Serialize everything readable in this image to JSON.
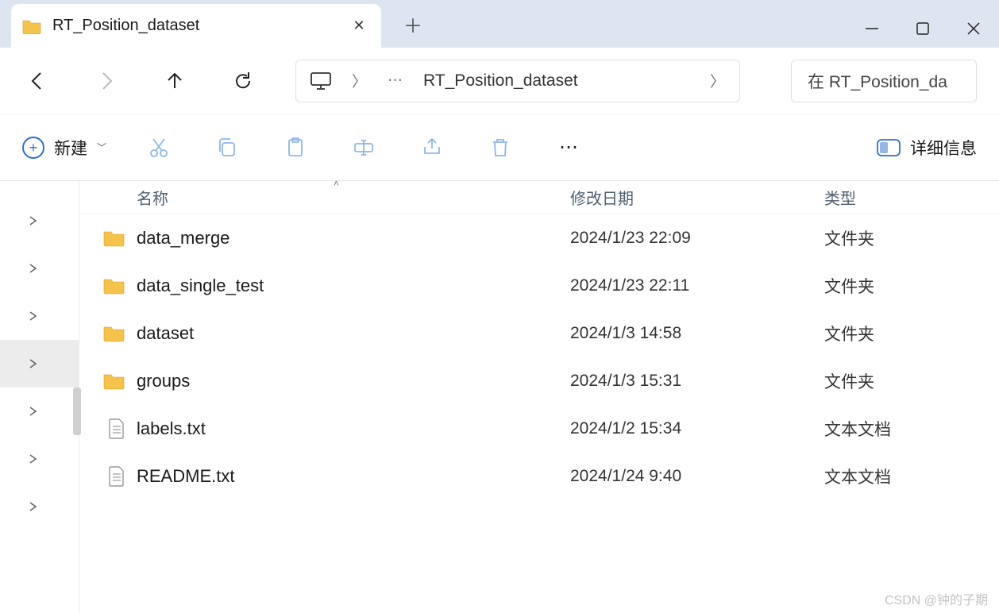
{
  "window": {
    "tab_title": "RT_Position_dataset"
  },
  "address": {
    "crumb": "RT_Position_dataset"
  },
  "search": {
    "placeholder": "在 RT_Position_da"
  },
  "toolbar": {
    "new_label": "新建",
    "details_label": "详细信息"
  },
  "columns": {
    "name": "名称",
    "modified": "修改日期",
    "type": "类型"
  },
  "files": [
    {
      "name": "data_merge",
      "date": "2024/1/23 22:09",
      "type": "文件夹",
      "kind": "folder"
    },
    {
      "name": "data_single_test",
      "date": "2024/1/23 22:11",
      "type": "文件夹",
      "kind": "folder"
    },
    {
      "name": "dataset",
      "date": "2024/1/3 14:58",
      "type": "文件夹",
      "kind": "folder"
    },
    {
      "name": "groups",
      "date": "2024/1/3 15:31",
      "type": "文件夹",
      "kind": "folder"
    },
    {
      "name": "labels.txt",
      "date": "2024/1/2 15:34",
      "type": "文本文档",
      "kind": "text"
    },
    {
      "name": "README.txt",
      "date": "2024/1/24 9:40",
      "type": "文本文档",
      "kind": "text"
    }
  ],
  "watermark": "CSDN @钟的子期"
}
